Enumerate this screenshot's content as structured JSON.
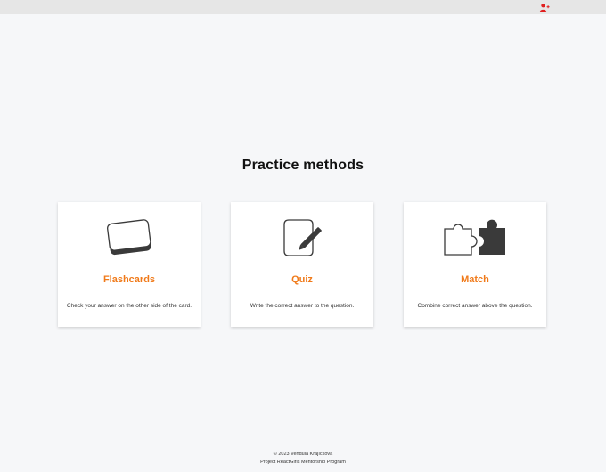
{
  "header": {
    "user_icon": "user-plus-icon",
    "accent_color": "#e02020"
  },
  "main": {
    "title": "Practice methods",
    "methods": [
      {
        "icon": "flashcards-icon",
        "name": "Flashcards",
        "description": "Check your answer on the other side of the card."
      },
      {
        "icon": "pencil-paper-icon",
        "name": "Quiz",
        "description": "Write the correct answer to the question."
      },
      {
        "icon": "puzzle-icon",
        "name": "Match",
        "description": "Combine correct answer above the question."
      }
    ],
    "accent_color": "#f07a1a"
  },
  "footer": {
    "line1": "© 2023 Vendula Krajíčková",
    "line2": "Project ReactGirls Mentorship Program"
  }
}
